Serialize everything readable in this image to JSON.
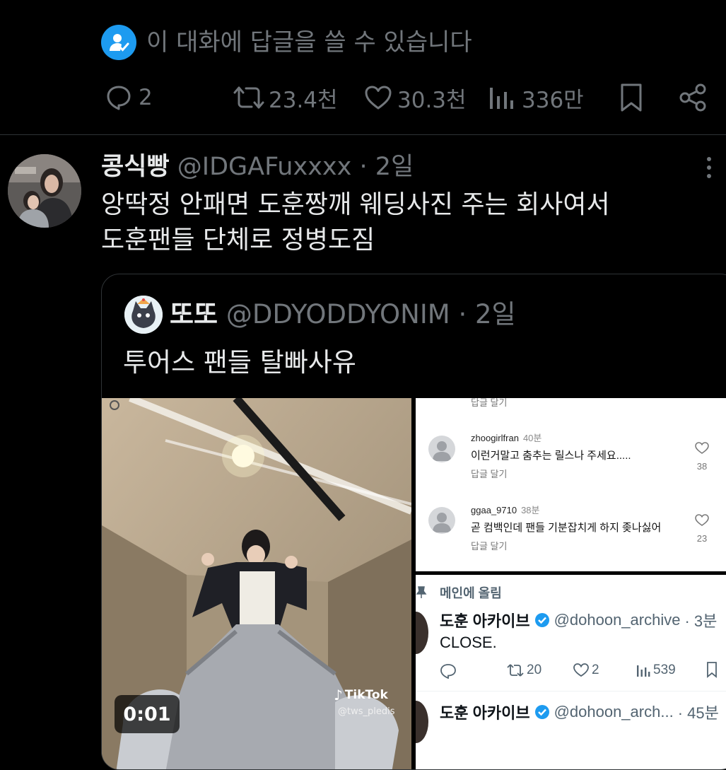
{
  "reply_notice": {
    "icon": "user-check-icon",
    "text": "이 대화에 답글을 쓸 수 있습니다"
  },
  "main_actions": {
    "replies": "2",
    "retweets": "23.4천",
    "likes": "30.3천",
    "views": "336만"
  },
  "reply_tweet": {
    "display_name": "콩식빵",
    "handle": "@IDGAFuxxxx",
    "sep": "·",
    "time": "2일",
    "text_line1": "앙딱정 안패면 도훈짱깨 웨딩사진 주는 회사여서",
    "text_line2": "도훈팬들 단체로 정병도짐"
  },
  "quoted_tweet": {
    "display_name": "또또",
    "handle": "@DDYODDYONIM",
    "sep": "·",
    "time": "2일",
    "text": "투어스 팬들 탈빠사유",
    "video": {
      "duration": "0:01",
      "watermark": "TikTok",
      "watermark_handle": "@tws_pledis"
    },
    "comments": {
      "top_cut": "답글 달기",
      "items": [
        {
          "user": "zhoogirlfran",
          "time": "40분",
          "text": "이런거말고 춤추는 릴스나 주세요.....",
          "reply": "답글 달기",
          "likes": "38"
        },
        {
          "user": "ggaa_9710",
          "time": "38분",
          "text": "곧 컴백인데 팬들 기분잡치게 하지 좆나싫어",
          "reply": "답글 달기",
          "likes": "23"
        }
      ]
    },
    "embedded": {
      "pinned_label": "메인에 올림",
      "posts": [
        {
          "name": "도훈 아카이브",
          "handle": "@dohoon_archive",
          "meta": "· 3분",
          "text": "CLOSE.",
          "retweets": "20",
          "likes": "2",
          "views": "539"
        },
        {
          "name": "도훈 아카이브",
          "handle": "@dohoon_arch...",
          "meta": "· 45분"
        }
      ]
    }
  },
  "colors": {
    "accent": "#1d9bf0",
    "muted": "#71767b",
    "verified": "#1d9bf0",
    "background": "#000000"
  }
}
